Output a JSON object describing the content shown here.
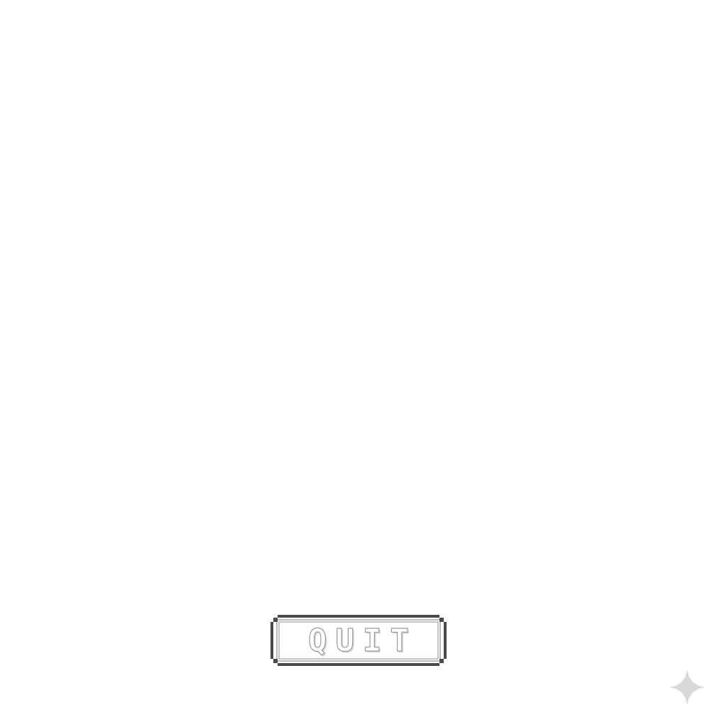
{
  "menu": {
    "quit_label": "QUIT"
  },
  "colors": {
    "background": "#ffffff",
    "button_border": "#4a4a4a",
    "button_text_outline": "#9a9a9a",
    "sparkle": "#d9d9d9"
  },
  "icons": {
    "corner_mark": "sparkle-icon"
  }
}
